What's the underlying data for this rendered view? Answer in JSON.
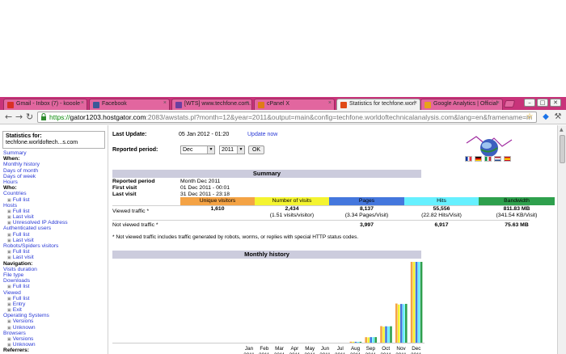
{
  "browser": {
    "tabs": [
      {
        "label": "Gmail - Inbox (7) - kooole",
        "favicon_color": "#d93025",
        "active": false
      },
      {
        "label": "Facebook",
        "favicon_color": "#3b5998",
        "active": false
      },
      {
        "label": "[WTS] www.techfone.com.",
        "favicon_color": "#6b3fa0",
        "active": false
      },
      {
        "label": "cPanel X",
        "favicon_color": "#e07b16",
        "active": false
      },
      {
        "label": "Statistics for techfone.worl",
        "favicon_color": "#e04a16",
        "active": true
      },
      {
        "label": "Google Analytics | Official",
        "favicon_color": "#e8a21a",
        "active": false
      }
    ],
    "close_glyph": "×",
    "window_controls": [
      "–",
      "□",
      "✕"
    ],
    "url": {
      "protocol": "https://",
      "host": "gator1203.hostgator.com",
      "path": ":2083/awstats.pl?month=12&year=2011&output=main&config=techfone.worldoftechnicalanalysis.com&lang=en&framename=m"
    }
  },
  "left_menu": {
    "stats_for_label": "Statistics for:",
    "site_name": "techfone.worldoftech...s.com",
    "items": [
      {
        "text": "Summary",
        "kind": "link"
      },
      {
        "text": "When:",
        "kind": "section"
      },
      {
        "text": "Monthly history",
        "kind": "link"
      },
      {
        "text": "Days of month",
        "kind": "link"
      },
      {
        "text": "Days of week",
        "kind": "link"
      },
      {
        "text": "Hours",
        "kind": "link"
      },
      {
        "text": "Who:",
        "kind": "section"
      },
      {
        "text": "Countries",
        "kind": "link"
      },
      {
        "text": "Full list",
        "kind": "sub"
      },
      {
        "text": "Hosts",
        "kind": "link"
      },
      {
        "text": "Full list",
        "kind": "sub"
      },
      {
        "text": "Last visit",
        "kind": "sub"
      },
      {
        "text": "Unresolved IP Address",
        "kind": "sub"
      },
      {
        "text": "Authenticated users",
        "kind": "link"
      },
      {
        "text": "Full list",
        "kind": "sub"
      },
      {
        "text": "Last visit",
        "kind": "sub"
      },
      {
        "text": "Robots/Spiders visitors",
        "kind": "link"
      },
      {
        "text": "Full list",
        "kind": "sub"
      },
      {
        "text": "Last visit",
        "kind": "sub"
      },
      {
        "text": "Navigation:",
        "kind": "section"
      },
      {
        "text": "Visits duration",
        "kind": "link"
      },
      {
        "text": "File type",
        "kind": "link"
      },
      {
        "text": "Downloads",
        "kind": "link"
      },
      {
        "text": "Full list",
        "kind": "sub"
      },
      {
        "text": "Viewed",
        "kind": "link"
      },
      {
        "text": "Full list",
        "kind": "sub"
      },
      {
        "text": "Entry",
        "kind": "sub"
      },
      {
        "text": "Exit",
        "kind": "sub"
      },
      {
        "text": "Operating Systems",
        "kind": "link"
      },
      {
        "text": "Versions",
        "kind": "sub"
      },
      {
        "text": "Unknown",
        "kind": "sub"
      },
      {
        "text": "Browsers",
        "kind": "link"
      },
      {
        "text": "Versions",
        "kind": "sub"
      },
      {
        "text": "Unknown",
        "kind": "sub"
      },
      {
        "text": "Referrers:",
        "kind": "section"
      }
    ]
  },
  "header": {
    "last_update_label": "Last Update:",
    "last_update_value": "05 Jan 2012 - 01:20",
    "update_now": "Update now",
    "reported_period_label": "Reported period:",
    "month_selected": "Dec",
    "year_selected": "2011",
    "ok_label": "OK"
  },
  "summary": {
    "heading": "Summary",
    "reported_period_label": "Reported period",
    "reported_period_value": "Month Dec 2011",
    "first_visit_label": "First visit",
    "first_visit_value": "01 Dec 2011 - 00:01",
    "last_visit_label": "Last visit",
    "last_visit_value": "31 Dec 2011 - 23:18",
    "columns": [
      {
        "label": "Unique visitors",
        "color": "#f4a345"
      },
      {
        "label": "Number of visits",
        "color": "#f4f430"
      },
      {
        "label": "Pages",
        "color": "#4477dd"
      },
      {
        "label": "Hits",
        "color": "#66f0ff"
      },
      {
        "label": "Bandwidth",
        "color": "#2ea04d"
      }
    ],
    "viewed_label": "Viewed traffic *",
    "viewed": {
      "unique_visitors": "1,610",
      "visits": "2,434",
      "visits_sub": "(1.51 visits/visitor)",
      "pages": "8,137",
      "pages_sub": "(3.34 Pages/Visit)",
      "hits": "55,556",
      "hits_sub": "(22.82 Hits/Visit)",
      "bandwidth": "811.83 MB",
      "bandwidth_sub": "(341.54 KB/Visit)"
    },
    "not_viewed_label": "Not viewed traffic *",
    "not_viewed": {
      "pages": "3,997",
      "hits": "6,917",
      "bandwidth": "75.63 MB"
    },
    "footnote": "* Not viewed traffic includes traffic generated by robots, worms, or replies with special HTTP status codes."
  },
  "monthly": {
    "heading": "Monthly history"
  },
  "chart_data": {
    "type": "bar",
    "categories": [
      "Jan 2011",
      "Feb 2011",
      "Mar 2011",
      "Apr 2011",
      "May 2011",
      "Jun 2011",
      "Jul 2011",
      "Aug 2011",
      "Sep 2011",
      "Oct 2011",
      "Nov 2011",
      "Dec 2011"
    ],
    "series_colors": [
      "#f4a345",
      "#f4f430",
      "#4477dd",
      "#66f0ff",
      "#2ea04d"
    ],
    "series": [
      {
        "values": [
          0,
          0,
          0,
          0,
          0,
          0,
          0,
          20,
          110,
          330,
          780,
          1610
        ]
      },
      {
        "values": [
          0,
          0,
          0,
          0,
          0,
          0,
          0,
          30,
          160,
          480,
          1150,
          2434
        ]
      },
      {
        "values": [
          0,
          0,
          0,
          0,
          0,
          0,
          0,
          90,
          560,
          1650,
          3900,
          8137
        ]
      },
      {
        "values": [
          0,
          0,
          0,
          0,
          0,
          0,
          0,
          600,
          3800,
          11200,
          26500,
          55556
        ]
      },
      {
        "values": [
          0,
          0,
          0,
          0,
          0,
          0,
          0,
          9,
          56,
          165,
          390,
          811.83
        ]
      }
    ]
  }
}
